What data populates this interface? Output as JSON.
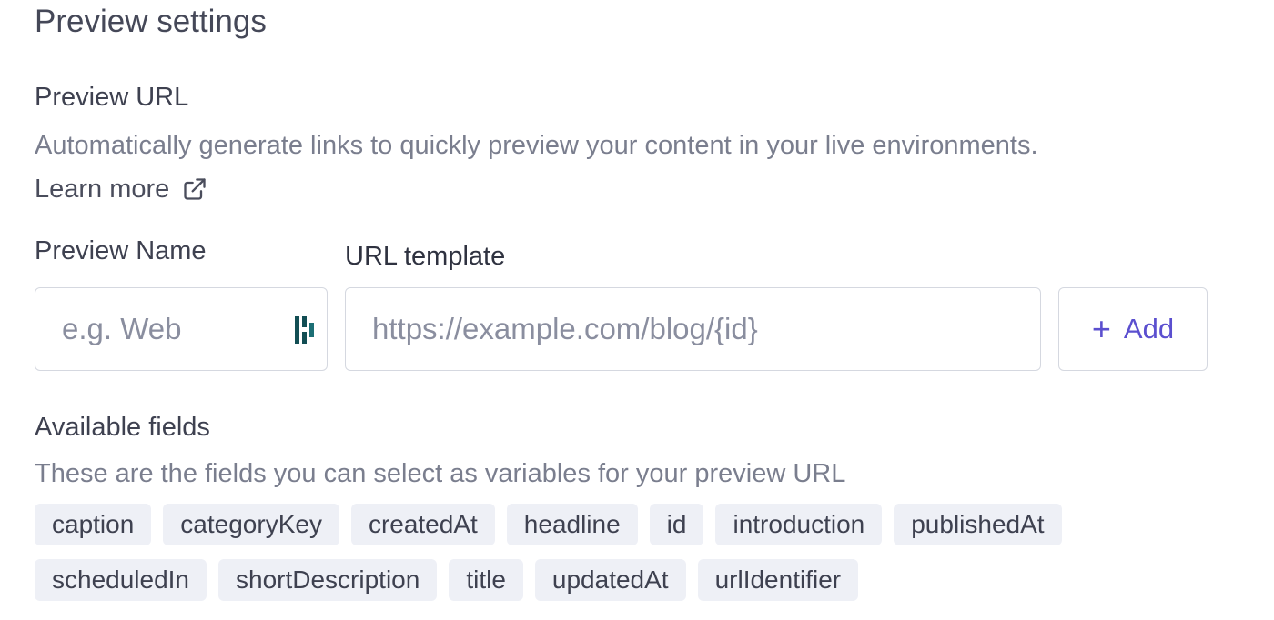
{
  "page": {
    "title": "Preview settings"
  },
  "preview_url": {
    "heading": "Preview URL",
    "description": "Automatically generate links to quickly preview your content in your live environments.",
    "learn_more_label": "Learn more",
    "learn_more_icon": "external-link-icon"
  },
  "form": {
    "name_label": "Preview Name",
    "name_value": "",
    "name_placeholder": "e.g. Web",
    "name_extension_icon": "password-manager-icon",
    "url_label": "URL template",
    "url_value": "",
    "url_placeholder": "https://example.com/blog/{id}",
    "add_button_label": "Add",
    "add_button_icon": "plus-icon",
    "accent_color": "#5b4fcf"
  },
  "available_fields": {
    "heading": "Available fields",
    "description": "These are the fields you can select as variables for your preview URL",
    "row_one": [
      "caption",
      "categoryKey",
      "createdAt",
      "headline",
      "id",
      "introduction",
      "publishedAt"
    ],
    "row_two": [
      "scheduledIn",
      "shortDescription",
      "title",
      "updatedAt",
      "urlIdentifier"
    ],
    "chip_background": "#eef0f6"
  }
}
